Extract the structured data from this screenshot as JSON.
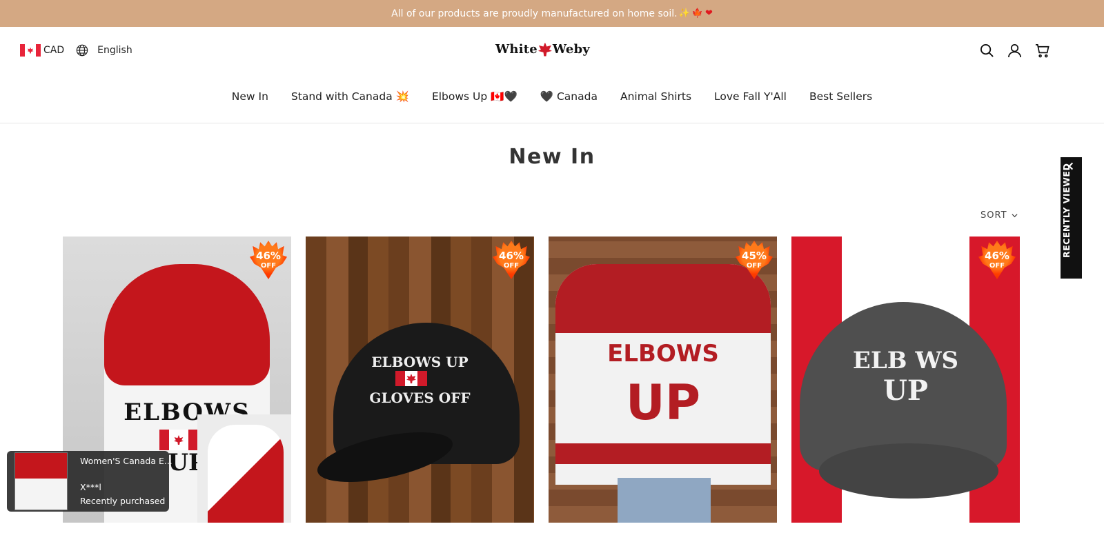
{
  "announcement": {
    "text": "All of our products are proudly manufactured on home soil.",
    "emojis": [
      "✨",
      "🍁",
      "❤"
    ]
  },
  "header": {
    "currency": "CAD",
    "language": "English",
    "logo_left": "White",
    "logo_right": "Weby",
    "icons": [
      "search-icon",
      "account-icon",
      "cart-icon"
    ]
  },
  "nav": {
    "items": [
      "New In",
      "Stand with Canada 💥",
      "Elbows Up 🇨🇦🖤",
      "🖤 Canada",
      "Animal Shirts",
      "Love Fall Y'All",
      "Best Sellers"
    ]
  },
  "page": {
    "title": "New In",
    "sort_label": "SORT"
  },
  "products": [
    {
      "discount": "46%",
      "off": "OFF",
      "art_line1": "ELBOWS",
      "art_line2": "UP"
    },
    {
      "discount": "46%",
      "off": "OFF",
      "art_line1": "ELBOWS UP",
      "art_line2": "GLOVES OFF"
    },
    {
      "discount": "45%",
      "off": "OFF",
      "art_line1": "ELBOWS",
      "art_line2": "UP"
    },
    {
      "discount": "46%",
      "off": "OFF",
      "art_line1": "ELB WS",
      "art_line2": "UP"
    }
  ],
  "recently_viewed": {
    "label": "RECENTLY VIEWED"
  },
  "toast": {
    "product_name": "Women'S Canada E...",
    "buyer": "X***l",
    "status": "Recently purchased"
  },
  "colors": {
    "announcement_bg": "#d4a883",
    "accent_red": "#d11a2a",
    "badge_orange": "#ff3d00"
  }
}
